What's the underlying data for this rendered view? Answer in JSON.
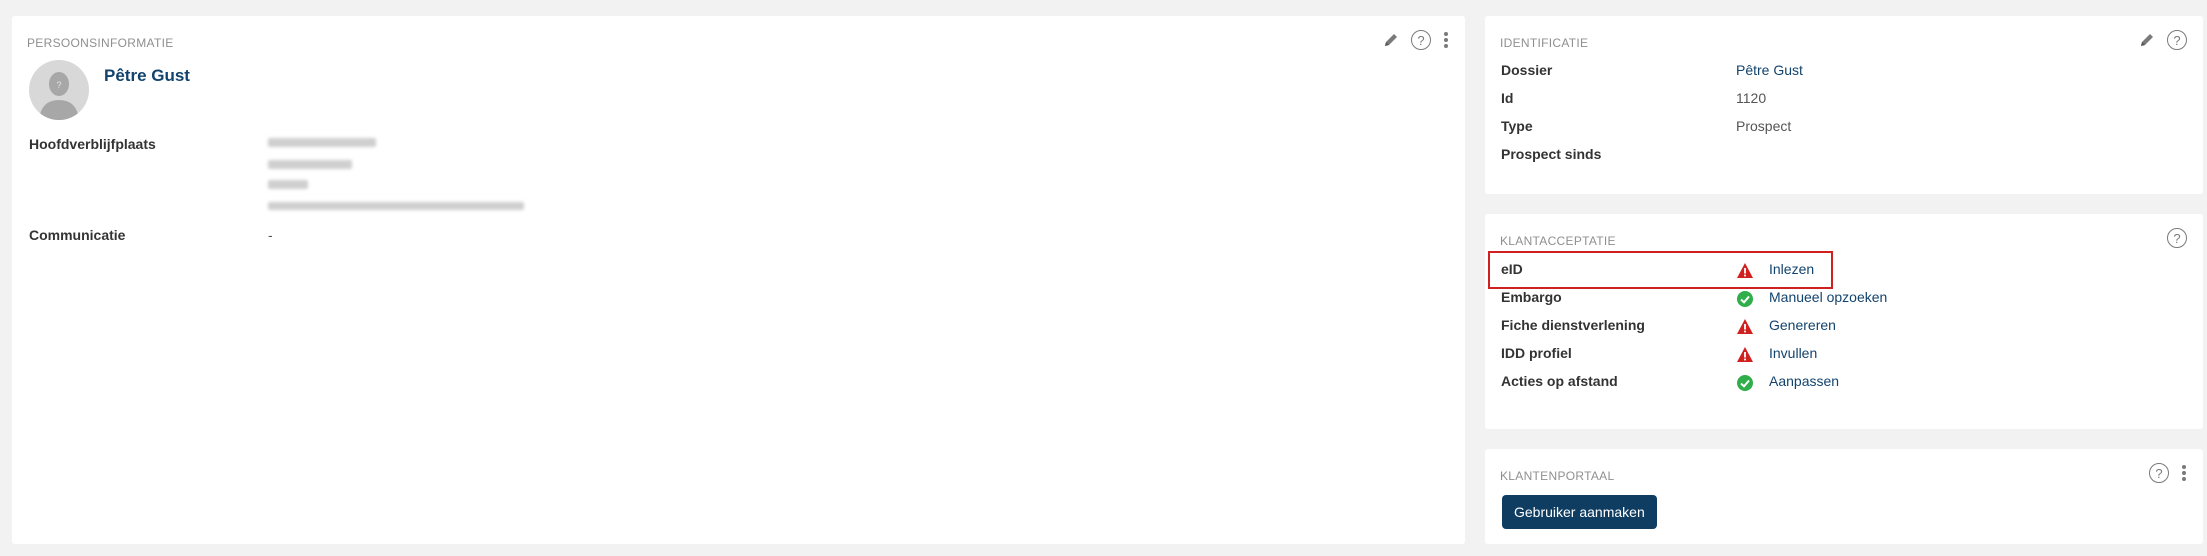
{
  "person": {
    "title": "PERSOONSINFORMATIE",
    "name": "Pêtre Gust",
    "labels": {
      "residence": "Hoofdverblijfplaats",
      "communication": "Communicatie"
    },
    "communication_value": "-"
  },
  "identification": {
    "title": "IDENTIFICATIE",
    "rows": [
      {
        "label": "Dossier",
        "value": "Pêtre Gust",
        "is_link": true
      },
      {
        "label": "Id",
        "value": "1120",
        "is_link": false
      },
      {
        "label": "Type",
        "value": "Prospect",
        "is_link": false
      },
      {
        "label": "Prospect sinds",
        "value": "",
        "is_link": false
      }
    ]
  },
  "acceptance": {
    "title": "KLANTACCEPTATIE",
    "rows": [
      {
        "label": "eID",
        "status": "warning",
        "action": "Inlezen",
        "highlighted": true
      },
      {
        "label": "Embargo",
        "status": "ok",
        "action": "Manueel opzoeken",
        "highlighted": false
      },
      {
        "label": "Fiche dienstverlening",
        "status": "warning",
        "action": "Genereren",
        "highlighted": false
      },
      {
        "label": "IDD profiel",
        "status": "warning",
        "action": "Invullen",
        "highlighted": false
      },
      {
        "label": "Acties op afstand",
        "status": "ok",
        "action": "Aanpassen",
        "highlighted": false
      }
    ]
  },
  "portal": {
    "title": "KLANTENPORTAAL",
    "create_user_label": "Gebruiker aanmaken"
  },
  "icons": {
    "edit": "pencil-icon",
    "help": "help-circle-icon",
    "more": "more-vertical-icon",
    "warning": "warning-triangle-icon",
    "ok": "check-circle-icon",
    "avatar": "user-silhouette-icon"
  },
  "colors": {
    "link": "#12436d",
    "warning": "#d0201f",
    "ok": "#2fae4a",
    "primary_button": "#0f3d62",
    "highlight_border": "#d0201f",
    "background": "#f2f2f3"
  }
}
